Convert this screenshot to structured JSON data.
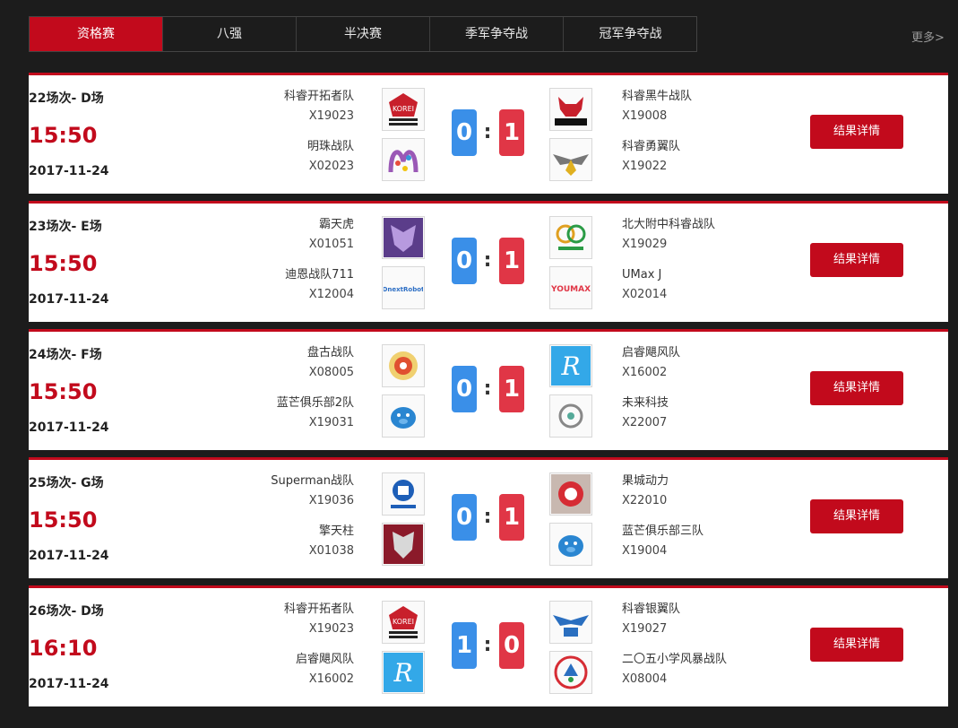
{
  "tabs": [
    "资格赛",
    "八强",
    "半决赛",
    "季军争夺战",
    "冠军争夺战"
  ],
  "more": "更多>",
  "detail_label": "结果详情",
  "matches": [
    {
      "round": "22场次- D场",
      "time": "15:50",
      "date": "2017-11-24",
      "score_left": "0",
      "score_right": "1",
      "left": [
        {
          "name": "科睿开拓者队",
          "code": "X19023",
          "logo": "pioneer-icon"
        },
        {
          "name": "明珠战队",
          "code": "X02023",
          "logo": "mingzhu-icon"
        }
      ],
      "right": [
        {
          "name": "科睿黑牛战队",
          "code": "X19008",
          "logo": "black-bull-icon"
        },
        {
          "name": "科睿勇翼队",
          "code": "X19022",
          "logo": "wings-icon"
        }
      ]
    },
    {
      "round": "23场次- E场",
      "time": "15:50",
      "date": "2017-11-24",
      "score_left": "0",
      "score_right": "1",
      "left": [
        {
          "name": "霸天虎",
          "code": "X01051",
          "logo": "decepticon-icon"
        },
        {
          "name": "迪恩战队711",
          "code": "X12004",
          "logo": "dnextrobot-icon"
        }
      ],
      "right": [
        {
          "name": "北大附中科睿战队",
          "code": "X19029",
          "logo": "rings-icon"
        },
        {
          "name": "UMax J",
          "code": "X02014",
          "logo": "youmax-icon"
        }
      ]
    },
    {
      "round": "24场次- F场",
      "time": "15:50",
      "date": "2017-11-24",
      "score_left": "0",
      "score_right": "1",
      "left": [
        {
          "name": "盘古战队",
          "code": "X08005",
          "logo": "pangu-icon"
        },
        {
          "name": "蓝芒俱乐部2队",
          "code": "X19031",
          "logo": "blue-pig-icon"
        }
      ],
      "right": [
        {
          "name": "启睿飓风队",
          "code": "X16002",
          "logo": "qirui-r-icon"
        },
        {
          "name": "未来科技",
          "code": "X22007",
          "logo": "future-tech-icon"
        }
      ]
    },
    {
      "round": "25场次- G场",
      "time": "15:50",
      "date": "2017-11-24",
      "score_left": "0",
      "score_right": "1",
      "left": [
        {
          "name": "Superman战队",
          "code": "X19036",
          "logo": "atomic-robot-icon"
        },
        {
          "name": "擎天柱",
          "code": "X01038",
          "logo": "autobot-icon"
        }
      ],
      "right": [
        {
          "name": "果城动力",
          "code": "X22010",
          "logo": "guocheng-icon"
        },
        {
          "name": "蓝芒俱乐部三队",
          "code": "X19004",
          "logo": "blue-pig-icon"
        }
      ]
    },
    {
      "round": "26场次- D场",
      "time": "16:10",
      "date": "2017-11-24",
      "score_left": "1",
      "score_right": "0",
      "left": [
        {
          "name": "科睿开拓者队",
          "code": "X19023",
          "logo": "pioneer-icon"
        },
        {
          "name": "启睿飓风队",
          "code": "X16002",
          "logo": "qirui-r-icon"
        }
      ],
      "right": [
        {
          "name": "科睿银翼队",
          "code": "X19027",
          "logo": "silver-wings-icon"
        },
        {
          "name": "二〇五小学风暴战队",
          "code": "X08004",
          "logo": "school-205-icon"
        }
      ]
    }
  ]
}
